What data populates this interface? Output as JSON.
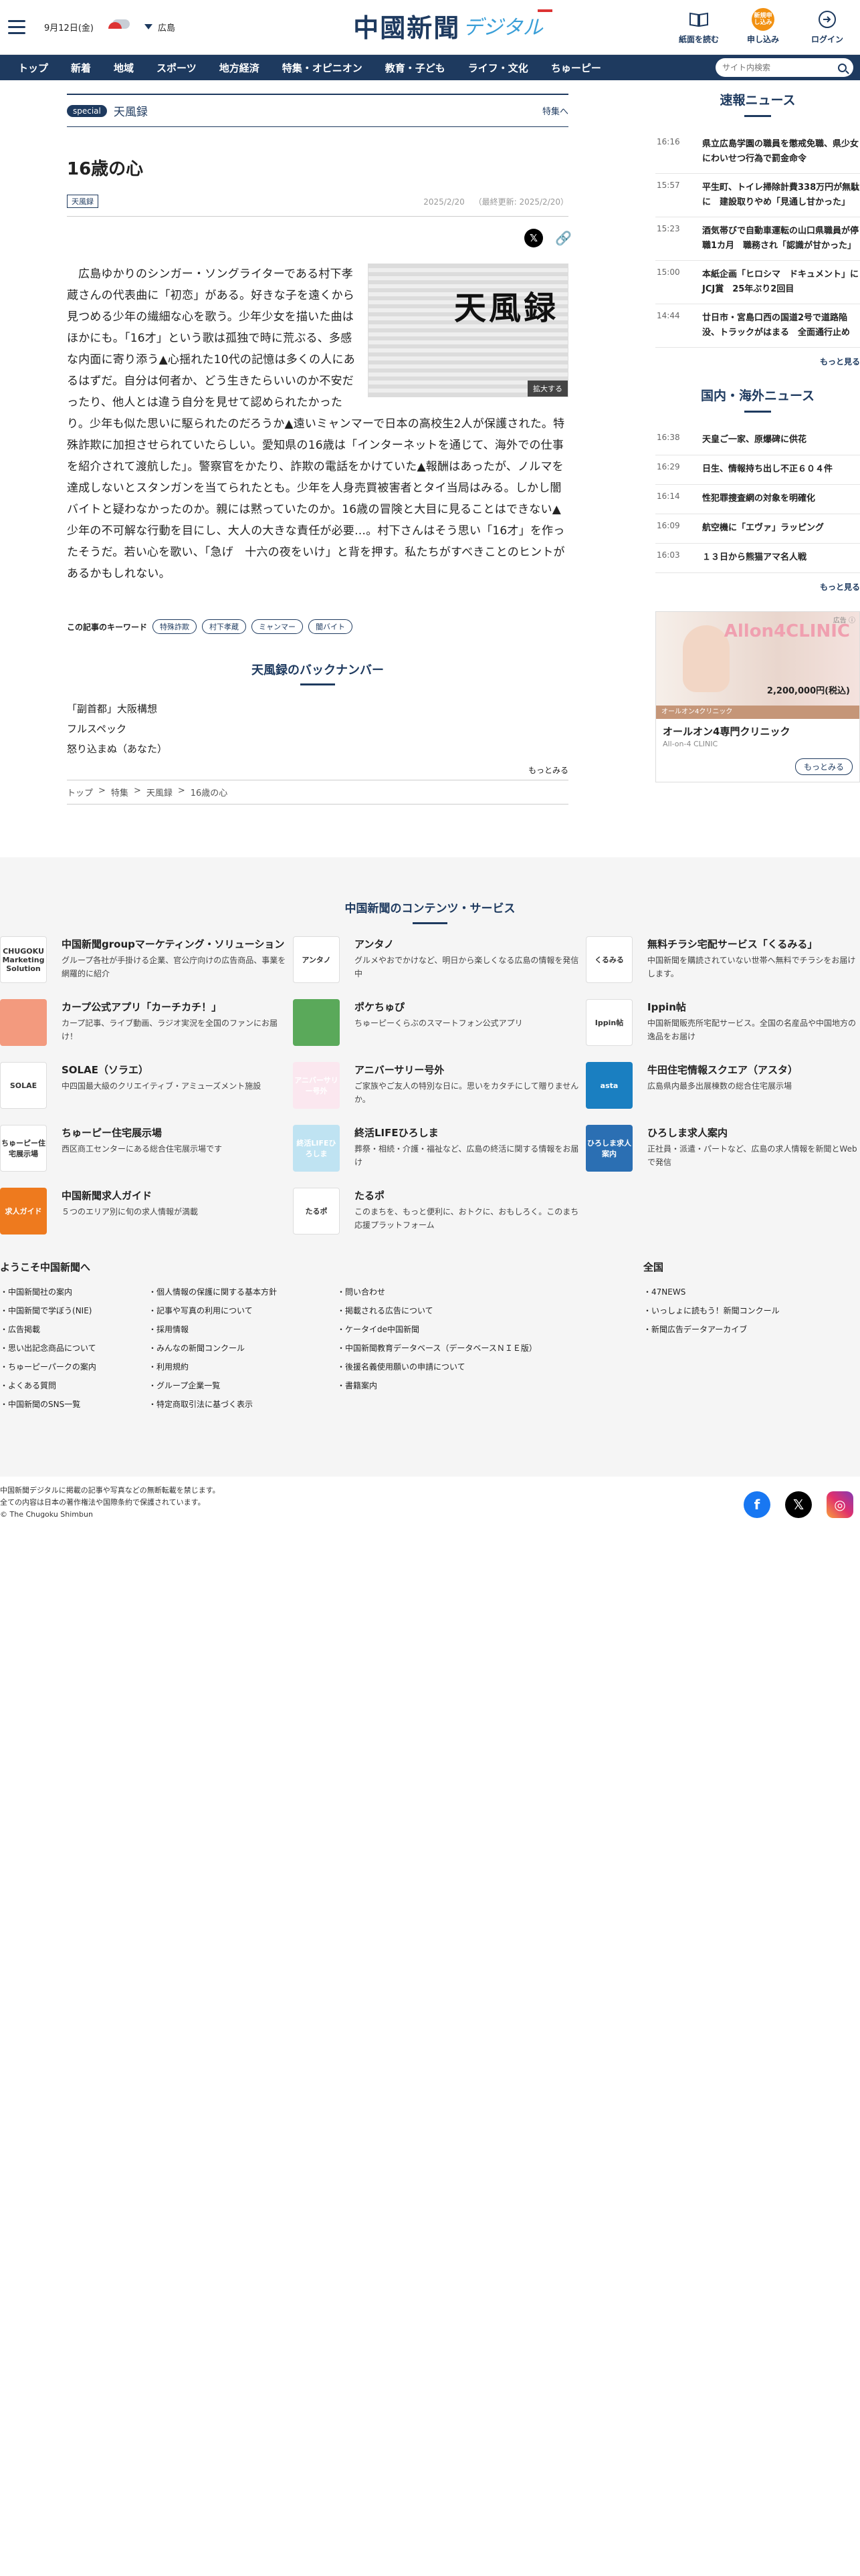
{
  "header": {
    "date": "9月12日(金)",
    "weather_region": "広島",
    "logo_main": "中國新聞",
    "logo_sub": "デジタル",
    "actions": [
      {
        "label": "紙面を読む"
      },
      {
        "label": "申し込み",
        "badge": "新規申し込み"
      },
      {
        "label": "ログイン"
      }
    ]
  },
  "nav": {
    "items": [
      "トップ",
      "新着",
      "地域",
      "スポーツ",
      "地方経済",
      "特集・オピニオン",
      "教育・子ども",
      "ライフ・文化",
      "ちゅーピー"
    ],
    "search_placeholder": "サイト内検索"
  },
  "article": {
    "special_badge": "special",
    "special_title": "天風録",
    "special_link": "特集へ",
    "title": "16歳の心",
    "category": "天風録",
    "date": "2025/2/20",
    "updated": "（最終更新: 2025/2/20）",
    "figure_text": "天風録",
    "zoom_label": "拡大する",
    "body": "広島ゆかりのシンガー・ソングライターである村下孝蔵さんの代表曲に「初恋」がある。好きな子を遠くから見つめる少年の繊細な心を歌う。少年少女を描いた曲はほかにも。「16才」という歌は孤独で時に荒ぶる、多感な内面に寄り添う▲心揺れた10代の記憶は多くの人にあるはずだ。自分は何者か、どう生きたらいいのか不安だったり、他人とは違う自分を見せて認められたかったり。少年も似た思いに駆られたのだろうか▲遠いミャンマーで日本の高校生2人が保護された。特殊詐欺に加担させられていたらしい。愛知県の16歳は「インターネットを通じて、海外での仕事を紹介されて渡航した」。警察官をかたり、詐欺の電話をかけていた▲報酬はあったが、ノルマを達成しないとスタンガンを当てられたとも。少年を人身売買被害者とタイ当局はみる。しかし闇バイトと疑わなかったのか。親には黙っていたのか。16歳の冒険と大目に見ることはできない▲少年の不可解な行動を目にし、大人の大きな責任が必要…。村下さんはそう思い「16才」を作ったそうだ。若い心を歌い、「急げ　十六の夜をいけ」と背を押す。私たちがすべきことのヒントがあるかもしれない。",
    "keywords_label": "この記事のキーワード",
    "keywords": [
      "特殊詐欺",
      "村下孝蔵",
      "ミャンマー",
      "闇バイト"
    ],
    "backnumber_title": "天風録のバックナンバー",
    "backnumbers": [
      "「副首都」大阪構想",
      "フルスペック",
      "怒り込まぬ（あなた）"
    ],
    "more": "もっとみる",
    "breadcrumb": [
      "トップ",
      ">",
      "特集",
      ">",
      "天風録",
      ">",
      "16歳の心"
    ]
  },
  "sidebar": {
    "breaking_title": "速報ニュース",
    "breaking": [
      {
        "time": "16:16",
        "headline": "県立広島学園の職員を懲戒免職、県少女にわいせつ行為で罰金命令"
      },
      {
        "time": "15:57",
        "headline": "平生町、トイレ掃除計費338万円が無駄に　建設取りやめ「見通し甘かった」"
      },
      {
        "time": "15:23",
        "headline": "酒気帯びで自動車運転の山口県職員が停職1カ月　職務され「認識が甘かった」"
      },
      {
        "time": "15:00",
        "headline": "本紙企画「ヒロシマ　ドキュメント」にJCJ賞　25年ぶり2回目"
      },
      {
        "time": "14:44",
        "headline": "廿日市・宮島口西の国道2号で道路陥没、トラックがはまる　全面通行止め"
      }
    ],
    "breaking_more": "もっと見る",
    "domestic_title": "国内・海外ニュース",
    "domestic": [
      {
        "time": "16:38",
        "headline": "天皇ご一家、原爆碑に供花"
      },
      {
        "time": "16:29",
        "headline": "日生、情報持ち出し不正６０４件"
      },
      {
        "time": "16:14",
        "headline": "性犯罪捜査網の対象を明確化"
      },
      {
        "time": "16:09",
        "headline": "航空機に「エヴァ」ラッピング"
      },
      {
        "time": "16:03",
        "headline": "１３日から熊猫アマ名人戦"
      }
    ],
    "domestic_more": "もっと見る",
    "ad": {
      "badge": "広告 ⓘ",
      "brand": "Allon4CLINIC",
      "price": "2,200,000円(税込)",
      "strip": "オールオン4クリニック",
      "title": "オールオン4専門クリニック",
      "sub": "All-on-4 CLINIC",
      "button": "もっとみる"
    }
  },
  "contents": {
    "title": "中国新聞のコンテンツ・サービス",
    "services": [
      {
        "icon": "marketing-logo",
        "title": "中国新聞groupマーケティング・ソリューション",
        "desc": "グループ各社が手掛ける企業、官公庁向けの広告商品、事業を網羅的に紹介",
        "color": "#ffffff",
        "icon_text": "CHUGOKU Marketing Solution"
      },
      {
        "icon": "antano-logo",
        "title": "アンタノ",
        "desc": "グルメやおでかけなど、明日から楽しくなる広島の情報を発信中",
        "color": "#ffffff",
        "icon_text": "アンタノ"
      },
      {
        "icon": "kurumu-logo",
        "title": "無料チラシ宅配サービス「くるみる」",
        "desc": "中国新聞を購読されていない世帯へ無料でチラシをお届けします。",
        "color": "#ffffff",
        "icon_text": "くるみる"
      },
      {
        "icon": "carpchika-logo",
        "title": "カープ公式アプリ「カーチカチ！」",
        "desc": "カープ記事、ライブ動画、ラジオ実況を全国のファンにお届け！",
        "color": "#f39a7e",
        "icon_text": ""
      },
      {
        "icon": "pokechupy-logo",
        "title": "ポケちゅぴ",
        "desc": "ちゅーピーくらぶのスマートフォン公式アプリ",
        "color": "#5aa95a",
        "icon_text": ""
      },
      {
        "icon": "ippin-logo",
        "title": "Ippin帖",
        "desc": "中国新聞販売所宅配サービス。全国の名産品や中国地方の逸品をお届け",
        "color": "#ffffff",
        "icon_text": "Ippin帖"
      },
      {
        "icon": "solae-logo",
        "title": "SOLAE（ソラエ）",
        "desc": "中四国最大級のクリエイティブ・アミューズメント施設",
        "color": "#ffffff",
        "icon_text": "SOLAE"
      },
      {
        "icon": "anniversary-logo",
        "title": "アニバーサリー号外",
        "desc": "ご家族やご友人の特別な日に。思いをカタチにして贈りませんか。",
        "color": "#fbe7ef",
        "icon_text": "アニバーサリー号外"
      },
      {
        "icon": "asta-logo",
        "title": "牛田住宅情報スクエア（アスタ）",
        "desc": "広島県内最多出展棟数の総合住宅展示場",
        "color": "#1a7fc1",
        "icon_text": "asta"
      },
      {
        "icon": "chupy-house-logo",
        "title": "ちゅーピー住宅展示場",
        "desc": "西区商工センターにある総合住宅展示場です",
        "color": "#ffffff",
        "icon_text": "ちゅーピー住宅展示場"
      },
      {
        "icon": "shukatsu-logo",
        "title": "終活LIFEひろしま",
        "desc": "葬祭・相続・介護・福祉など、広島の終活に関する情報をお届け",
        "color": "#bfe3f2",
        "icon_text": "終活LIFEひろしま"
      },
      {
        "icon": "hiroshima-jobs-logo",
        "title": "ひろしま求人案内",
        "desc": "正社員・派遣・パートなど、広島の求人情報を新聞とWebで発信",
        "color": "#2b6fb3",
        "icon_text": "ひろしま求人案内"
      },
      {
        "icon": "kyujin-guide-logo",
        "title": "中国新聞求人ガイド",
        "desc": "５つのエリア別に旬の求人情報が満載",
        "color": "#ee7a1e",
        "icon_text": "求人ガイド"
      },
      {
        "icon": "tarupo-logo",
        "title": "たるポ",
        "desc": "このまちを、もっと便利に、おトクに、おもしろく。このまち応援プラットフォーム",
        "color": "#ffffff",
        "icon_text": "たるポ"
      }
    ],
    "welcome_title": "ようこそ中国新聞へ",
    "welcome_cols": [
      [
        "中国新聞社の案内",
        "中国新聞で学ぼう(NIE)",
        "広告掲載",
        "思い出記念商品について",
        "ちゅーピーパークの案内",
        "よくある質問",
        "中国新聞のSNS一覧"
      ],
      [
        "個人情報の保護に関する基本方針",
        "記事や写真の利用について",
        "採用情報",
        "みんなの新聞コンクール",
        "利用規約",
        "グループ企業一覧",
        "特定商取引法に基づく表示"
      ],
      [
        "問い合わせ",
        "掲載される広告について",
        "ケータイde中国新聞",
        "中国新聞教育データベース（データベースＮＩＥ版）",
        "後援名義使用願いの申請について",
        "書籍案内"
      ]
    ],
    "national_title": "全国",
    "national": [
      "47NEWS",
      "いっしょに読もう！新聞コンクール",
      "新聞広告データアーカイブ"
    ]
  },
  "footer": {
    "copy1": "中国新聞デジタルに掲載の記事や写真などの無断転載を禁じます。",
    "copy2": "全ての内容は日本の著作権法や国際条約で保護されています。",
    "copy3": "© The Chugoku Shimbun"
  },
  "colors": {
    "brand": "#1e3a5f",
    "accent": "#f29111",
    "sky": "#3a9fd8"
  }
}
